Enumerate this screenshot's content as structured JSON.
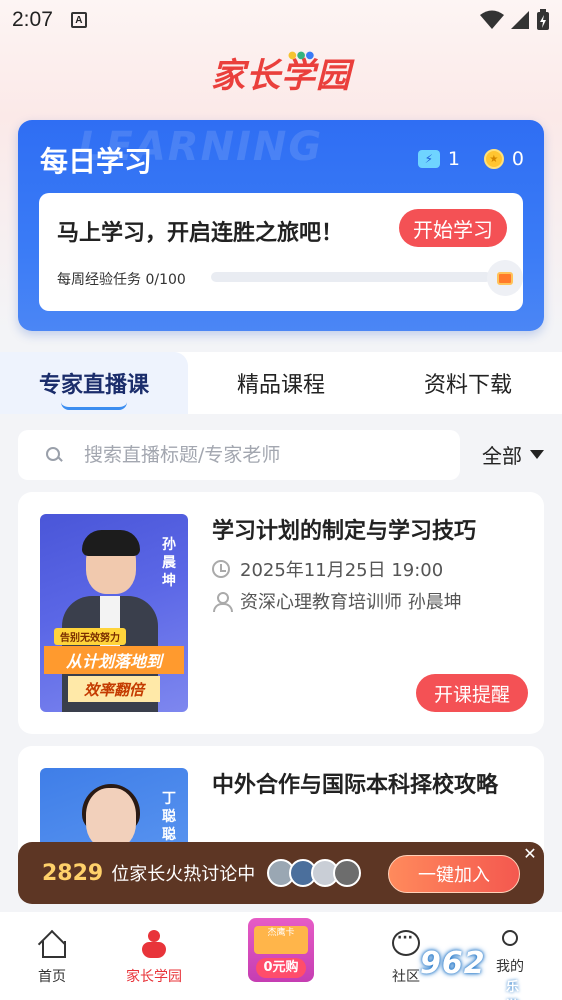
{
  "status_bar": {
    "time": "2:07",
    "notification_icon": "A"
  },
  "header": {
    "app_logo_text": "家长学园"
  },
  "daily_card": {
    "title": "每日学习",
    "watermark": "LEARNING",
    "streak_count": "1",
    "coin_count": "0",
    "message": "马上学习，开启连胜之旅吧！",
    "start_button": "开始学习",
    "weekly_task": "每周经验任务 0/100",
    "weekly_progress": 0
  },
  "tabs": [
    {
      "label": "专家直播课",
      "active": true
    },
    {
      "label": "精品课程",
      "active": false
    },
    {
      "label": "资料下载",
      "active": false
    }
  ],
  "search": {
    "placeholder": "搜索直播标题/专家老师",
    "value": "",
    "filter_label": "全部"
  },
  "courses": [
    {
      "title": "学习计划的制定与学习技巧",
      "datetime": "2025年11月25日 19:00",
      "teacher": "资深心理教育培训师 孙晨坤",
      "remind_button": "开课提醒",
      "thumb_name": "孙晨坤",
      "thumb_tag1": "告别无效努力",
      "thumb_tag2": "从计划落地到",
      "thumb_tag3": "效率翻倍"
    },
    {
      "title": "中外合作与国际本科择校攻略",
      "thumb_name": "丁聪聪"
    }
  ],
  "join_banner": {
    "count": "2829",
    "text": "位家长火热讨论中",
    "button": "一键加入",
    "close": "✕"
  },
  "bottom_nav": {
    "home": "首页",
    "garden": "家长学园",
    "promo_top": "杰鹰卡",
    "promo_buy": "0元购",
    "community": "社区",
    "me": "我的"
  },
  "watermark": {
    "main": "962",
    "sub": "乐游网"
  },
  "colors": {
    "accent_red": "#f45155",
    "card_blue": "#3a7bf6",
    "banner_brown": "#5d3624"
  }
}
